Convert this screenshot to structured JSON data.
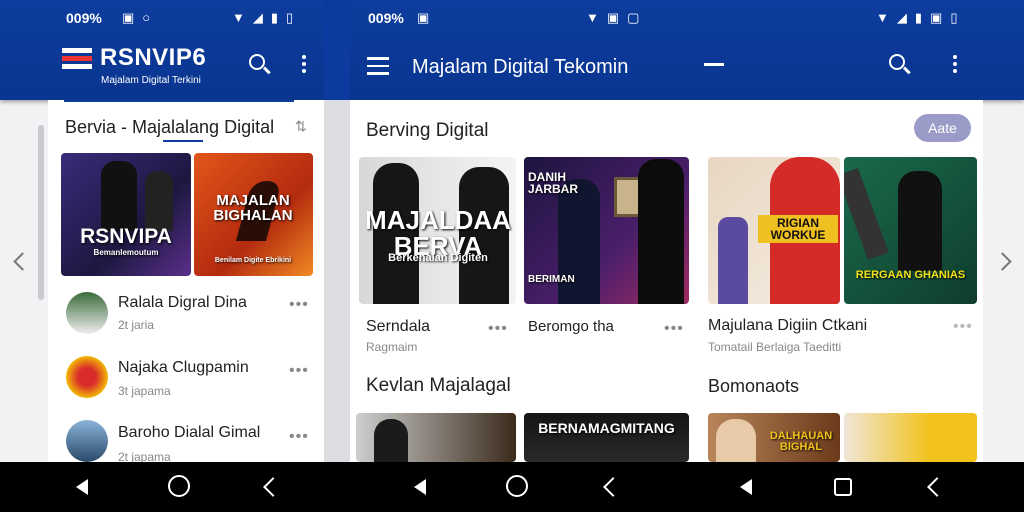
{
  "left_phone": {
    "status_time": "009%",
    "app_title": "RSNVIP6",
    "app_subtitle": "Majalam Digital Terkini",
    "section_title": "Bervia - Majalalang Digital",
    "thumbs": [
      {
        "label": "RSNVIPA",
        "sublabel": "Bemanlemoutum"
      },
      {
        "label": "MAJALAN BIGHALAN",
        "sublabel": "Benilam Digite Ebrikini"
      }
    ],
    "list": [
      {
        "title": "Ralala Digral Dina",
        "sub": "2t jaria"
      },
      {
        "title": "Najaka Clugpamin",
        "sub": "3t japama"
      },
      {
        "title": "Baroho Dialal Gimal",
        "sub": "2t japama"
      }
    ],
    "more": "•••"
  },
  "right_phone": {
    "status_time": "009%",
    "app_title": "Majalam Digital Tekomin",
    "section_title": "Berving Digital",
    "pill": "Aate",
    "items": [
      {
        "title": "Serndala",
        "sub": "Ragmaim",
        "thumb_label": "MAJALDAA BERVA",
        "thumb_sub": "Berkenalan Digiten"
      },
      {
        "title": "Beromgo tha",
        "sub": "",
        "thumb_label": "DANIH JARBAR",
        "thumb_sub": "BERIMAN"
      },
      {
        "title": "Majulana Digiin Ctkani",
        "sub": "Tomatail Berlaiga Taeditti",
        "thumb_label": "RIGIAN WORKUE",
        "thumb_sub": "RERGAAN GHANIAS"
      }
    ],
    "section2": "Kevlan Majalagal",
    "section3": "Bomonaots",
    "row2_labels": [
      "BERNAMAGMITANG",
      "DALHAUAN BIGHAL"
    ],
    "more": "•••"
  },
  "colors": {
    "primary": "#0d3d9e",
    "accent_red": "#e33333"
  }
}
